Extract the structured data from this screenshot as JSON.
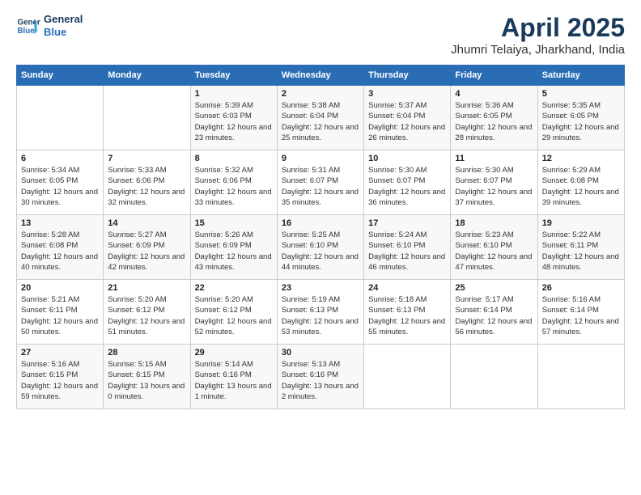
{
  "logo": {
    "line1": "General",
    "line2": "Blue"
  },
  "title": "April 2025",
  "subtitle": "Jhumri Telaiya, Jharkhand, India",
  "weekdays": [
    "Sunday",
    "Monday",
    "Tuesday",
    "Wednesday",
    "Thursday",
    "Friday",
    "Saturday"
  ],
  "weeks": [
    [
      {
        "day": "",
        "info": ""
      },
      {
        "day": "",
        "info": ""
      },
      {
        "day": "1",
        "info": "Sunrise: 5:39 AM\nSunset: 6:03 PM\nDaylight: 12 hours\nand 23 minutes."
      },
      {
        "day": "2",
        "info": "Sunrise: 5:38 AM\nSunset: 6:04 PM\nDaylight: 12 hours\nand 25 minutes."
      },
      {
        "day": "3",
        "info": "Sunrise: 5:37 AM\nSunset: 6:04 PM\nDaylight: 12 hours\nand 26 minutes."
      },
      {
        "day": "4",
        "info": "Sunrise: 5:36 AM\nSunset: 6:05 PM\nDaylight: 12 hours\nand 28 minutes."
      },
      {
        "day": "5",
        "info": "Sunrise: 5:35 AM\nSunset: 6:05 PM\nDaylight: 12 hours\nand 29 minutes."
      }
    ],
    [
      {
        "day": "6",
        "info": "Sunrise: 5:34 AM\nSunset: 6:05 PM\nDaylight: 12 hours\nand 30 minutes."
      },
      {
        "day": "7",
        "info": "Sunrise: 5:33 AM\nSunset: 6:06 PM\nDaylight: 12 hours\nand 32 minutes."
      },
      {
        "day": "8",
        "info": "Sunrise: 5:32 AM\nSunset: 6:06 PM\nDaylight: 12 hours\nand 33 minutes."
      },
      {
        "day": "9",
        "info": "Sunrise: 5:31 AM\nSunset: 6:07 PM\nDaylight: 12 hours\nand 35 minutes."
      },
      {
        "day": "10",
        "info": "Sunrise: 5:30 AM\nSunset: 6:07 PM\nDaylight: 12 hours\nand 36 minutes."
      },
      {
        "day": "11",
        "info": "Sunrise: 5:30 AM\nSunset: 6:07 PM\nDaylight: 12 hours\nand 37 minutes."
      },
      {
        "day": "12",
        "info": "Sunrise: 5:29 AM\nSunset: 6:08 PM\nDaylight: 12 hours\nand 39 minutes."
      }
    ],
    [
      {
        "day": "13",
        "info": "Sunrise: 5:28 AM\nSunset: 6:08 PM\nDaylight: 12 hours\nand 40 minutes."
      },
      {
        "day": "14",
        "info": "Sunrise: 5:27 AM\nSunset: 6:09 PM\nDaylight: 12 hours\nand 42 minutes."
      },
      {
        "day": "15",
        "info": "Sunrise: 5:26 AM\nSunset: 6:09 PM\nDaylight: 12 hours\nand 43 minutes."
      },
      {
        "day": "16",
        "info": "Sunrise: 5:25 AM\nSunset: 6:10 PM\nDaylight: 12 hours\nand 44 minutes."
      },
      {
        "day": "17",
        "info": "Sunrise: 5:24 AM\nSunset: 6:10 PM\nDaylight: 12 hours\nand 46 minutes."
      },
      {
        "day": "18",
        "info": "Sunrise: 5:23 AM\nSunset: 6:10 PM\nDaylight: 12 hours\nand 47 minutes."
      },
      {
        "day": "19",
        "info": "Sunrise: 5:22 AM\nSunset: 6:11 PM\nDaylight: 12 hours\nand 48 minutes."
      }
    ],
    [
      {
        "day": "20",
        "info": "Sunrise: 5:21 AM\nSunset: 6:11 PM\nDaylight: 12 hours\nand 50 minutes."
      },
      {
        "day": "21",
        "info": "Sunrise: 5:20 AM\nSunset: 6:12 PM\nDaylight: 12 hours\nand 51 minutes."
      },
      {
        "day": "22",
        "info": "Sunrise: 5:20 AM\nSunset: 6:12 PM\nDaylight: 12 hours\nand 52 minutes."
      },
      {
        "day": "23",
        "info": "Sunrise: 5:19 AM\nSunset: 6:13 PM\nDaylight: 12 hours\nand 53 minutes."
      },
      {
        "day": "24",
        "info": "Sunrise: 5:18 AM\nSunset: 6:13 PM\nDaylight: 12 hours\nand 55 minutes."
      },
      {
        "day": "25",
        "info": "Sunrise: 5:17 AM\nSunset: 6:14 PM\nDaylight: 12 hours\nand 56 minutes."
      },
      {
        "day": "26",
        "info": "Sunrise: 5:16 AM\nSunset: 6:14 PM\nDaylight: 12 hours\nand 57 minutes."
      }
    ],
    [
      {
        "day": "27",
        "info": "Sunrise: 5:16 AM\nSunset: 6:15 PM\nDaylight: 12 hours\nand 59 minutes."
      },
      {
        "day": "28",
        "info": "Sunrise: 5:15 AM\nSunset: 6:15 PM\nDaylight: 13 hours\nand 0 minutes."
      },
      {
        "day": "29",
        "info": "Sunrise: 5:14 AM\nSunset: 6:16 PM\nDaylight: 13 hours\nand 1 minute."
      },
      {
        "day": "30",
        "info": "Sunrise: 5:13 AM\nSunset: 6:16 PM\nDaylight: 13 hours\nand 2 minutes."
      },
      {
        "day": "",
        "info": ""
      },
      {
        "day": "",
        "info": ""
      },
      {
        "day": "",
        "info": ""
      }
    ]
  ]
}
